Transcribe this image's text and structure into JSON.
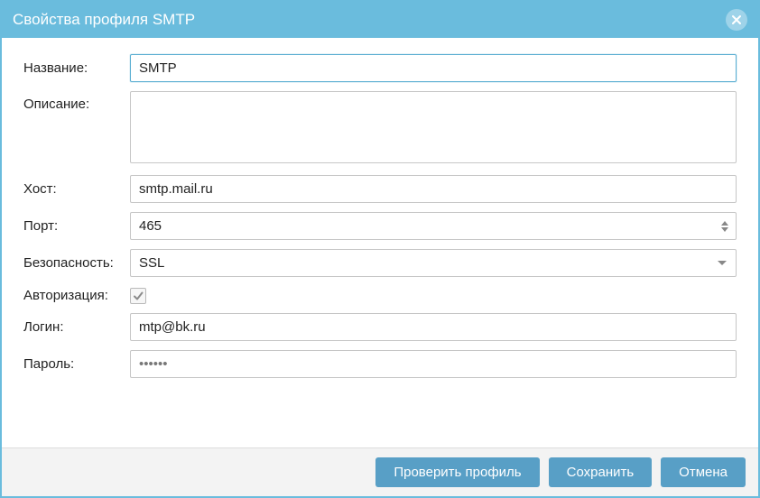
{
  "dialog": {
    "title": "Свойства профиля SMTP"
  },
  "labels": {
    "name": "Название:",
    "description": "Описание:",
    "host": "Хост:",
    "port": "Порт:",
    "security": "Безопасность:",
    "auth": "Авторизация:",
    "login": "Логин:",
    "password": "Пароль:"
  },
  "values": {
    "name": "SMTP",
    "description": "",
    "host": "smtp.mail.ru",
    "port": "465",
    "security": "SSL",
    "auth_checked": true,
    "login": "mtp@bk.ru",
    "password": "••••••"
  },
  "buttons": {
    "test": "Проверить профиль",
    "save": "Сохранить",
    "cancel": "Отмена"
  }
}
